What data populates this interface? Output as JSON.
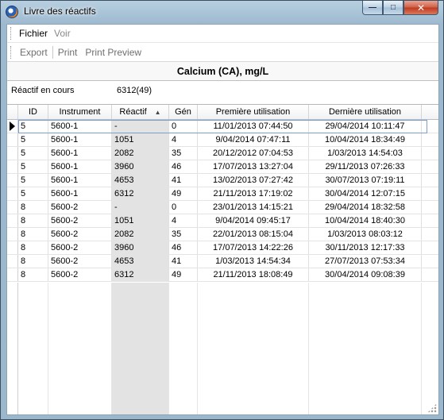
{
  "window": {
    "title": "Livre des réactifs",
    "controls": {
      "minimize": "—",
      "maximize": "□",
      "close": "✕"
    }
  },
  "menu": {
    "items": [
      "Fichier",
      "Voir"
    ]
  },
  "toolbar": {
    "export": "Export",
    "print": "Print",
    "print_preview": "Print Preview"
  },
  "header": {
    "title": "Calcium (CA), mg/L"
  },
  "current": {
    "label": "Réactif en cours",
    "value": "6312(49)"
  },
  "grid": {
    "columns": [
      "ID",
      "Instrument",
      "Réactif",
      "Gén",
      "Première utilisation",
      "Dernière utilisation"
    ],
    "sorted_column": "Réactif",
    "rows": [
      [
        "5",
        "5600-1",
        "-",
        "0",
        "11/01/2013 07:44:50",
        "29/04/2014 10:11:47"
      ],
      [
        "5",
        "5600-1",
        "1051",
        "4",
        "9/04/2014 07:47:11",
        "10/04/2014 18:34:49"
      ],
      [
        "5",
        "5600-1",
        "2082",
        "35",
        "20/12/2012 07:04:53",
        "1/03/2013 14:54:03"
      ],
      [
        "5",
        "5600-1",
        "3960",
        "46",
        "17/07/2013 13:27:04",
        "29/11/2013 07:26:33"
      ],
      [
        "5",
        "5600-1",
        "4653",
        "41",
        "13/02/2013 07:27:42",
        "30/07/2013 07:19:11"
      ],
      [
        "5",
        "5600-1",
        "6312",
        "49",
        "21/11/2013 17:19:02",
        "30/04/2014 12:07:15"
      ],
      [
        "8",
        "5600-2",
        "-",
        "0",
        "23/01/2013 14:15:21",
        "29/04/2014 18:32:58"
      ],
      [
        "8",
        "5600-2",
        "1051",
        "4",
        "9/04/2014 09:45:17",
        "10/04/2014 18:40:30"
      ],
      [
        "8",
        "5600-2",
        "2082",
        "35",
        "22/01/2013 08:15:04",
        "1/03/2013 08:03:12"
      ],
      [
        "8",
        "5600-2",
        "3960",
        "46",
        "17/07/2013 14:22:26",
        "30/11/2013 12:17:33"
      ],
      [
        "8",
        "5600-2",
        "4653",
        "41",
        "1/03/2013 14:54:34",
        "27/07/2013 07:53:34"
      ],
      [
        "8",
        "5600-2",
        "6312",
        "49",
        "21/11/2013 18:08:49",
        "30/04/2014 09:08:39"
      ]
    ]
  }
}
